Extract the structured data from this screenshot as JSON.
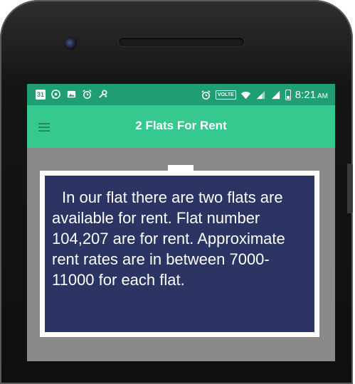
{
  "status_bar": {
    "calendar_day": "31",
    "volte": "VOLTE",
    "time": "8:21",
    "ampm": "AM",
    "left_icons": [
      "whatsapp-icon",
      "image-icon",
      "alarm-icon",
      "settings-sync-icon"
    ],
    "right_icons": [
      "alarm-icon",
      "volte-badge",
      "wifi-icon",
      "signal-icon",
      "signal-icon",
      "battery-icon"
    ]
  },
  "app_bar": {
    "title": "2 Flats For Rent",
    "menu_icon": "hamburger-menu-icon"
  },
  "card": {
    "text": "In our flat there are two flats are available for rent. Flat number 104,207 are for rent. Approximate rent rates are in between 7000-11000 for each flat."
  },
  "colors": {
    "status_bar": "#1f9e76",
    "app_bar": "#35c88f",
    "card_background": "#2b3462",
    "content_background": "#8a8a8a"
  }
}
